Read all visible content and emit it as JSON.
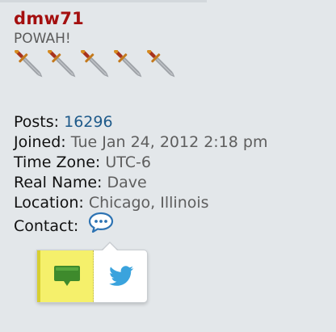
{
  "post_profile": {
    "username": "dmw71",
    "rank_title": "POWAH!",
    "rank_icon_count": 5,
    "fields": [
      {
        "label": "Posts:",
        "value": "16296",
        "is_link": true
      },
      {
        "label": "Joined:",
        "value": "Tue Jan 24, 2012 2:18 pm",
        "is_link": false
      },
      {
        "label": "Time Zone:",
        "value": "UTC-6",
        "is_link": false
      },
      {
        "label": "Real Name:",
        "value": "Dave",
        "is_link": false
      },
      {
        "label": "Location:",
        "value": "Chicago, Illinois",
        "is_link": false
      }
    ],
    "contact_label": "Contact:"
  },
  "contact_popup": {
    "options": [
      {
        "name": "private-message",
        "icon": "message-bubble-icon"
      },
      {
        "name": "twitter",
        "icon": "twitter-bird-icon"
      }
    ]
  },
  "colors": {
    "username": "#a40f0f",
    "link": "#1e5a8a",
    "pm_highlight": "#f5f06b",
    "twitter_blue": "#3aa3dd"
  }
}
